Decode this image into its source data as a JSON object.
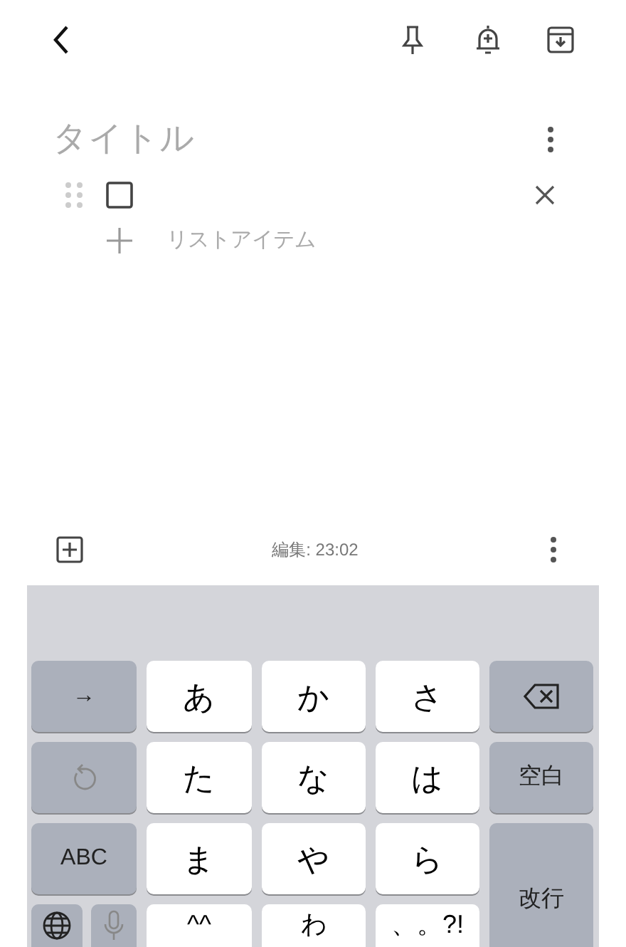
{
  "note": {
    "title_placeholder": "タイトル",
    "items": [
      {
        "checked": false
      }
    ],
    "add_item_placeholder": "リストアイテム"
  },
  "bottom_bar": {
    "edited": "編集: 23:02"
  },
  "keyboard": {
    "keys": [
      {
        "kind": "function",
        "label": "→"
      },
      {
        "kind": "letter",
        "label": "あ"
      },
      {
        "kind": "letter",
        "label": "か"
      },
      {
        "kind": "letter",
        "label": "さ"
      },
      {
        "kind": "delete"
      },
      {
        "kind": "undo"
      },
      {
        "kind": "letter",
        "label": "た"
      },
      {
        "kind": "letter",
        "label": "な"
      },
      {
        "kind": "letter",
        "label": "は"
      },
      {
        "kind": "function",
        "label": "空白"
      },
      {
        "kind": "function",
        "label": "ABC"
      },
      {
        "kind": "letter",
        "label": "ま"
      },
      {
        "kind": "letter",
        "label": "や"
      },
      {
        "kind": "letter",
        "label": "ら"
      },
      {
        "kind": "return",
        "label": "改行"
      },
      {
        "kind": "pair"
      },
      {
        "kind": "letter",
        "label": "^^"
      },
      {
        "kind": "letter",
        "label": "わ"
      },
      {
        "kind": "letter",
        "label": "、。?!"
      }
    ]
  }
}
